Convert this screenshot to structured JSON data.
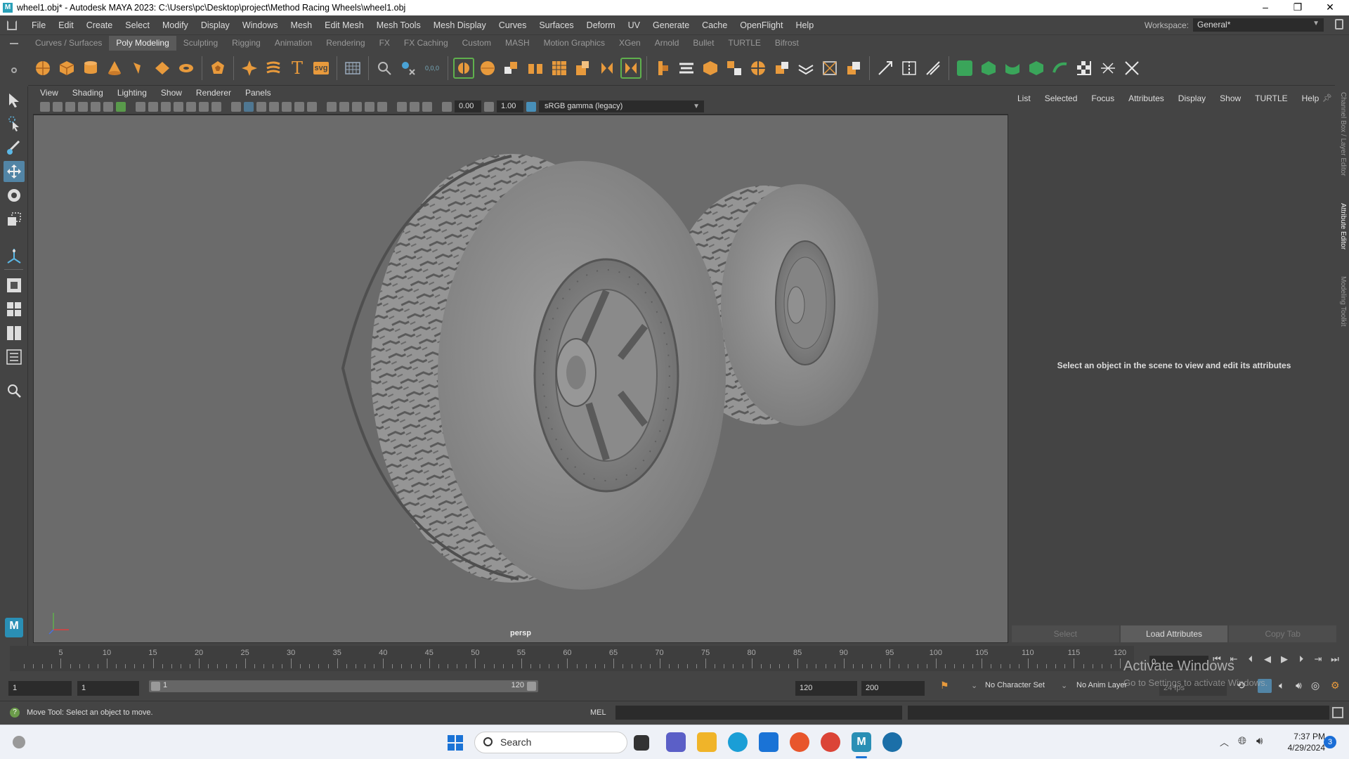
{
  "window": {
    "title": "wheel1.obj* - Autodesk MAYA 2023: C:\\Users\\pc\\Desktop\\project\\Method Racing Wheels\\wheel1.obj",
    "minimize": "–",
    "restore": "❐",
    "close": "✕"
  },
  "menubar": {
    "items": [
      "File",
      "Edit",
      "Create",
      "Select",
      "Modify",
      "Display",
      "Windows",
      "Mesh",
      "Edit Mesh",
      "Mesh Tools",
      "Mesh Display",
      "Curves",
      "Surfaces",
      "Deform",
      "UV",
      "Generate",
      "Cache",
      "OpenFlight",
      "Help"
    ],
    "workspace_label": "Workspace:",
    "workspace_value": "General*"
  },
  "shelf": {
    "tabs": [
      "Curves / Surfaces",
      "Poly Modeling",
      "Sculpting",
      "Rigging",
      "Animation",
      "Rendering",
      "FX",
      "FX Caching",
      "Custom",
      "MASH",
      "Motion Graphics",
      "XGen",
      "Arnold",
      "Bullet",
      "TURTLE",
      "Bifrost"
    ],
    "active_tab": "Poly Modeling",
    "icon_text": {
      "text_tool": "T",
      "svg_tool": "svg",
      "coords": "0,0,0"
    }
  },
  "viewport": {
    "menu": [
      "View",
      "Shading",
      "Lighting",
      "Show",
      "Renderer",
      "Panels"
    ],
    "exposure": "0.00",
    "gamma": "1.00",
    "color_space": "sRGB gamma (legacy)",
    "camera": "persp"
  },
  "attribute_editor": {
    "menu": [
      "List",
      "Selected",
      "Focus",
      "Attributes",
      "Display",
      "Show",
      "TURTLE",
      "Help"
    ],
    "message": "Select an object in the scene to view and edit its attributes",
    "buttons": {
      "select": "Select",
      "load": "Load Attributes",
      "copy": "Copy Tab"
    }
  },
  "side_tabs": [
    "Channel Box / Layer Editor",
    "Attribute Editor",
    "Modeling Toolkit"
  ],
  "timeline": {
    "ticks": [
      5,
      10,
      15,
      20,
      25,
      30,
      35,
      40,
      45,
      50,
      55,
      60,
      65,
      70,
      75,
      80,
      85,
      90,
      95,
      100,
      105,
      110,
      115,
      120
    ],
    "min": 1,
    "max": 120,
    "current_frame": "0"
  },
  "range": {
    "start": "1",
    "start2": "1",
    "slider_start": "1",
    "slider_end": "120",
    "end": "120",
    "end2": "200",
    "character_set": "No Character Set",
    "anim_layer": "No Anim Layer",
    "fps": "24 fps"
  },
  "watermark": {
    "line1": "Activate Windows",
    "line2": "Go to Settings to activate Windows."
  },
  "help": {
    "text": "Move Tool: Select an object to move.",
    "mel": "MEL"
  },
  "taskbar": {
    "search": "Search",
    "time": "7:37 PM",
    "date": "4/29/2024",
    "notifications": "3"
  },
  "colors": {
    "maya_orange": "#e89a3c",
    "maya_green": "#5fb04d",
    "accent_blue": "#5285a6",
    "viewport_bg": "#6b6b6b"
  }
}
